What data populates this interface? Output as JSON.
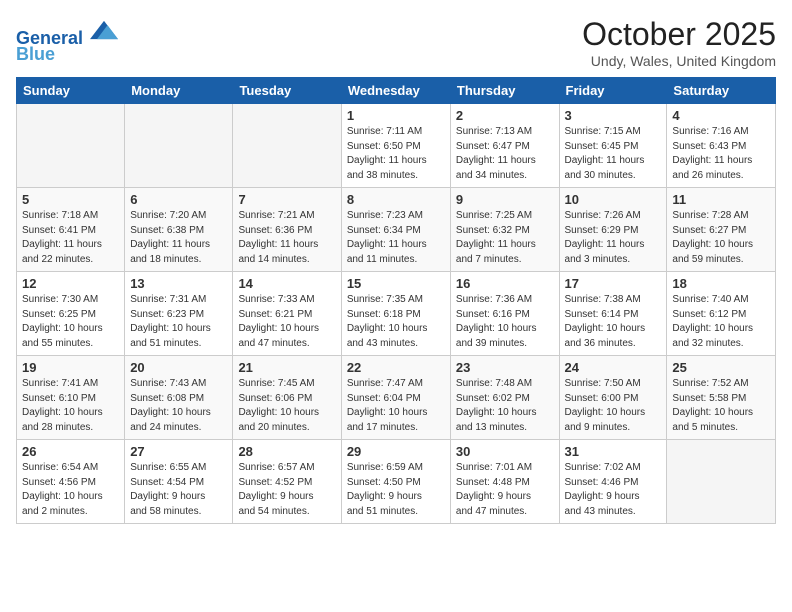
{
  "header": {
    "logo_line1": "General",
    "logo_line2": "Blue",
    "month_title": "October 2025",
    "location": "Undy, Wales, United Kingdom"
  },
  "days_of_week": [
    "Sunday",
    "Monday",
    "Tuesday",
    "Wednesday",
    "Thursday",
    "Friday",
    "Saturday"
  ],
  "weeks": [
    [
      {
        "num": "",
        "info": ""
      },
      {
        "num": "",
        "info": ""
      },
      {
        "num": "",
        "info": ""
      },
      {
        "num": "1",
        "info": "Sunrise: 7:11 AM\nSunset: 6:50 PM\nDaylight: 11 hours\nand 38 minutes."
      },
      {
        "num": "2",
        "info": "Sunrise: 7:13 AM\nSunset: 6:47 PM\nDaylight: 11 hours\nand 34 minutes."
      },
      {
        "num": "3",
        "info": "Sunrise: 7:15 AM\nSunset: 6:45 PM\nDaylight: 11 hours\nand 30 minutes."
      },
      {
        "num": "4",
        "info": "Sunrise: 7:16 AM\nSunset: 6:43 PM\nDaylight: 11 hours\nand 26 minutes."
      }
    ],
    [
      {
        "num": "5",
        "info": "Sunrise: 7:18 AM\nSunset: 6:41 PM\nDaylight: 11 hours\nand 22 minutes."
      },
      {
        "num": "6",
        "info": "Sunrise: 7:20 AM\nSunset: 6:38 PM\nDaylight: 11 hours\nand 18 minutes."
      },
      {
        "num": "7",
        "info": "Sunrise: 7:21 AM\nSunset: 6:36 PM\nDaylight: 11 hours\nand 14 minutes."
      },
      {
        "num": "8",
        "info": "Sunrise: 7:23 AM\nSunset: 6:34 PM\nDaylight: 11 hours\nand 11 minutes."
      },
      {
        "num": "9",
        "info": "Sunrise: 7:25 AM\nSunset: 6:32 PM\nDaylight: 11 hours\nand 7 minutes."
      },
      {
        "num": "10",
        "info": "Sunrise: 7:26 AM\nSunset: 6:29 PM\nDaylight: 11 hours\nand 3 minutes."
      },
      {
        "num": "11",
        "info": "Sunrise: 7:28 AM\nSunset: 6:27 PM\nDaylight: 10 hours\nand 59 minutes."
      }
    ],
    [
      {
        "num": "12",
        "info": "Sunrise: 7:30 AM\nSunset: 6:25 PM\nDaylight: 10 hours\nand 55 minutes."
      },
      {
        "num": "13",
        "info": "Sunrise: 7:31 AM\nSunset: 6:23 PM\nDaylight: 10 hours\nand 51 minutes."
      },
      {
        "num": "14",
        "info": "Sunrise: 7:33 AM\nSunset: 6:21 PM\nDaylight: 10 hours\nand 47 minutes."
      },
      {
        "num": "15",
        "info": "Sunrise: 7:35 AM\nSunset: 6:18 PM\nDaylight: 10 hours\nand 43 minutes."
      },
      {
        "num": "16",
        "info": "Sunrise: 7:36 AM\nSunset: 6:16 PM\nDaylight: 10 hours\nand 39 minutes."
      },
      {
        "num": "17",
        "info": "Sunrise: 7:38 AM\nSunset: 6:14 PM\nDaylight: 10 hours\nand 36 minutes."
      },
      {
        "num": "18",
        "info": "Sunrise: 7:40 AM\nSunset: 6:12 PM\nDaylight: 10 hours\nand 32 minutes."
      }
    ],
    [
      {
        "num": "19",
        "info": "Sunrise: 7:41 AM\nSunset: 6:10 PM\nDaylight: 10 hours\nand 28 minutes."
      },
      {
        "num": "20",
        "info": "Sunrise: 7:43 AM\nSunset: 6:08 PM\nDaylight: 10 hours\nand 24 minutes."
      },
      {
        "num": "21",
        "info": "Sunrise: 7:45 AM\nSunset: 6:06 PM\nDaylight: 10 hours\nand 20 minutes."
      },
      {
        "num": "22",
        "info": "Sunrise: 7:47 AM\nSunset: 6:04 PM\nDaylight: 10 hours\nand 17 minutes."
      },
      {
        "num": "23",
        "info": "Sunrise: 7:48 AM\nSunset: 6:02 PM\nDaylight: 10 hours\nand 13 minutes."
      },
      {
        "num": "24",
        "info": "Sunrise: 7:50 AM\nSunset: 6:00 PM\nDaylight: 10 hours\nand 9 minutes."
      },
      {
        "num": "25",
        "info": "Sunrise: 7:52 AM\nSunset: 5:58 PM\nDaylight: 10 hours\nand 5 minutes."
      }
    ],
    [
      {
        "num": "26",
        "info": "Sunrise: 6:54 AM\nSunset: 4:56 PM\nDaylight: 10 hours\nand 2 minutes."
      },
      {
        "num": "27",
        "info": "Sunrise: 6:55 AM\nSunset: 4:54 PM\nDaylight: 9 hours\nand 58 minutes."
      },
      {
        "num": "28",
        "info": "Sunrise: 6:57 AM\nSunset: 4:52 PM\nDaylight: 9 hours\nand 54 minutes."
      },
      {
        "num": "29",
        "info": "Sunrise: 6:59 AM\nSunset: 4:50 PM\nDaylight: 9 hours\nand 51 minutes."
      },
      {
        "num": "30",
        "info": "Sunrise: 7:01 AM\nSunset: 4:48 PM\nDaylight: 9 hours\nand 47 minutes."
      },
      {
        "num": "31",
        "info": "Sunrise: 7:02 AM\nSunset: 4:46 PM\nDaylight: 9 hours\nand 43 minutes."
      },
      {
        "num": "",
        "info": ""
      }
    ]
  ]
}
